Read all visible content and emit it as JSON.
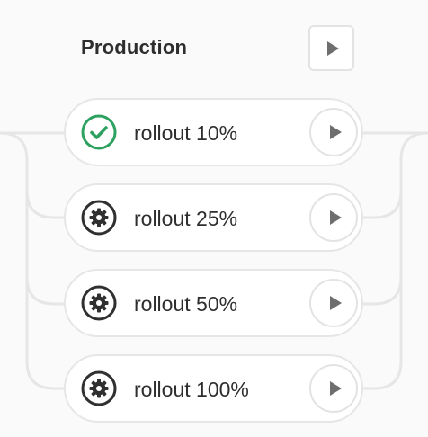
{
  "stage": {
    "title": "Production",
    "play_icon": "play-icon"
  },
  "jobs": [
    {
      "label": "rollout 10%",
      "status": "success",
      "status_icon": "check-circle-icon",
      "status_color": "#2da160",
      "action_icon": "play-icon"
    },
    {
      "label": "rollout 25%",
      "status": "manual",
      "status_icon": "gear-icon",
      "status_color": "#303030",
      "action_icon": "play-icon"
    },
    {
      "label": "rollout 50%",
      "status": "manual",
      "status_icon": "gear-icon",
      "status_color": "#303030",
      "action_icon": "play-icon"
    },
    {
      "label": "rollout 100%",
      "status": "manual",
      "status_icon": "gear-icon",
      "status_color": "#303030",
      "action_icon": "play-icon"
    }
  ],
  "colors": {
    "connector": "#e6e6e6",
    "success": "#2da160",
    "manual": "#303030",
    "play": "#6e6e6e"
  }
}
